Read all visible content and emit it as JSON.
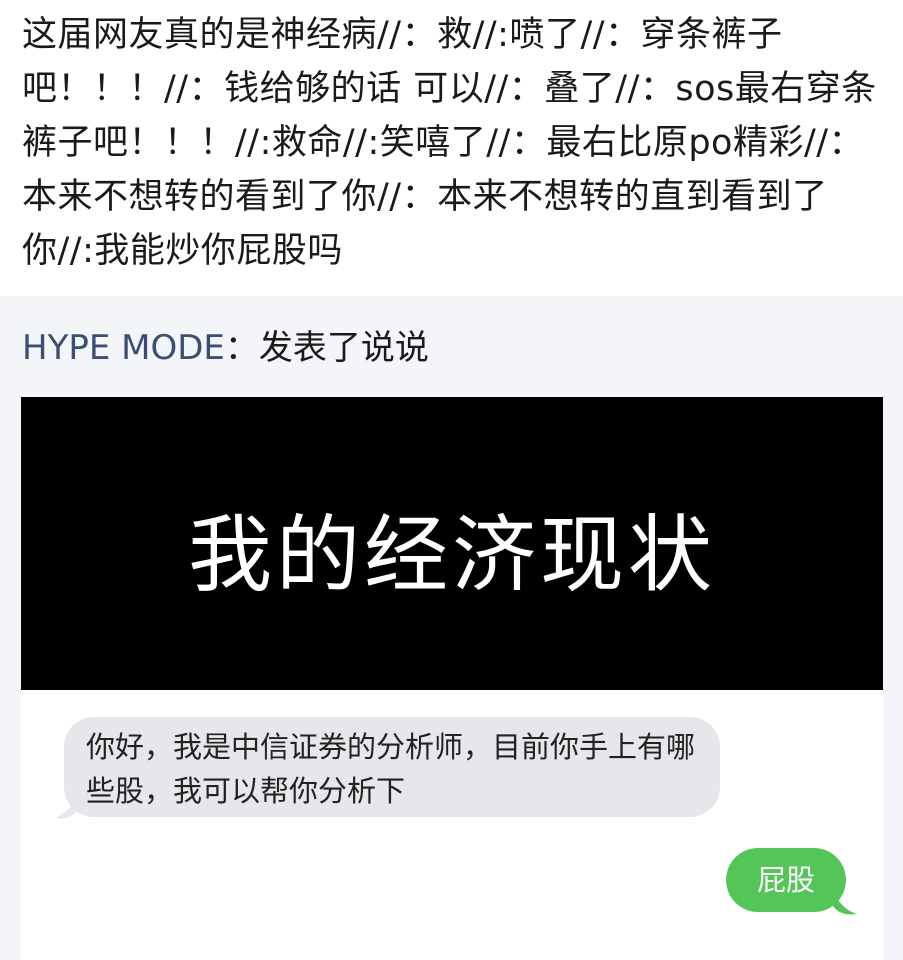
{
  "post": {
    "text": "这届网友真的是神经病//：救//:喷了//：穿条裤子吧！！！//：钱给够的话 可以//：叠了//：sos最右穿条裤子吧！！！//:救命//:笑嘻了//：最右比原po精彩//：本来不想转的看到了你//：本来不想转的直到看到了你//:我能炒你屁股吗"
  },
  "share": {
    "author": "HYPE MODE",
    "action": "：发表了说说"
  },
  "meme": {
    "caption": "我的经济现状",
    "chat": {
      "incoming": "你好，我是中信证券的分析师，目前你手上有哪些股，我可以帮你分析下",
      "outgoing": "屁股"
    }
  },
  "colors": {
    "author": "#3b4f73",
    "card_background": "#f3f5f9",
    "incoming_bubble": "#e6e6eb",
    "outgoing_bubble": "#54c657"
  }
}
